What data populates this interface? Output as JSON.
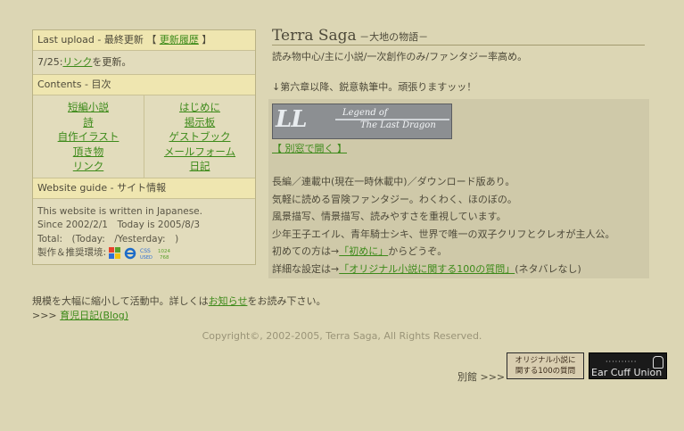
{
  "left": {
    "upload": {
      "label": "Last upload - 最終更新 【",
      "history_link": "更新履歴",
      "close": "】"
    },
    "update": {
      "date": "7/25:",
      "link": "リンク",
      "text": "を更新。"
    },
    "contents_header": "Contents - 目次",
    "nav_left": [
      "短編小説",
      "詩",
      "自作イラスト",
      "頂き物",
      "リンク"
    ],
    "nav_right": [
      "はじめに",
      "掲示板",
      "ゲストブック",
      "メールフォーム",
      "日記"
    ],
    "guide_header": "Website guide - サイト情報",
    "guide": {
      "line1": "This website is written in Japanese.",
      "line2": "Since 2002/2/1　Today is 2005/8/3",
      "line3": "Total:　(Today:　/Yesterday:　)",
      "env": "製作＆推奨環境:",
      "res": "1024×768"
    }
  },
  "header": {
    "title": "Terra Saga",
    "subtitle": "－大地の物語－",
    "tagline": "読み物中心/主に小説/一次創作のみ/ファンタジー率高め。",
    "notice": "↓第六章以降、鋭意執筆中。頑張りますッッ！"
  },
  "panel": {
    "banner": {
      "ll": "LL",
      "line1": "Legend of",
      "line2": "The Last Dragon"
    },
    "popup": "【 別窓で開く 】",
    "desc": [
      "長編／連載中(現在一時休載中)／ダウンロード版あり。",
      "気軽に読める冒険ファンタジー。わくわく、ほのぼの。",
      "風景描写、情景描写、読みやすさを重視しています。",
      "少年王子エイル、青年騎士シキ、世界で唯一の双子クリフとクレオが主人公。"
    ],
    "first": {
      "pre": "初めての方は→",
      "link": "「初めに」",
      "post": "からどうぞ。"
    },
    "detail": {
      "pre": "詳細な設定は→",
      "link": "「オリジナル小説に関する100の質問」",
      "post": "(ネタバレなし)"
    }
  },
  "footer": {
    "msg": {
      "pre": "規模を大幅に縮小して活動中。詳しくは",
      "link": "お知らせ",
      "post": "をお読み下さい。"
    },
    "blog": {
      "pre": ">>> ",
      "link": "育児日記(Blog)"
    },
    "copyright": "Copyright©, 2002-2005, Terra Saga, All Rights Reserved.",
    "annex": "別館 >>>",
    "qbtn_line1": "オリジナル小説に",
    "qbtn_line2": "関する100の質問",
    "ecu": "Ear Cuff Union"
  }
}
